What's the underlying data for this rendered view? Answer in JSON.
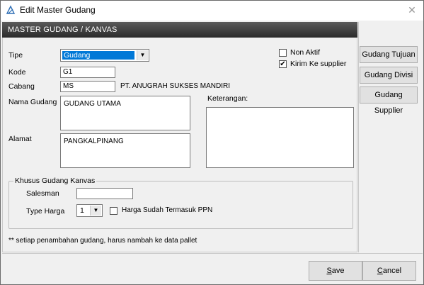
{
  "window": {
    "title": "Edit Master Gudang"
  },
  "header": {
    "title": "MASTER  GUDANG / KANVAS"
  },
  "form": {
    "tipe_label": "Tipe",
    "tipe_value": "Gudang",
    "kode_label": "Kode",
    "kode_value": "G1",
    "cabang_label": "Cabang",
    "cabang_value": "MS",
    "cabang_name": "PT. ANUGRAH SUKSES MANDIRI",
    "nama_label": "Nama Gudang",
    "nama_value": "GUDANG UTAMA",
    "alamat_label": "Alamat",
    "alamat_value": "PANGKALPINANG",
    "keterangan_label": "Keterangan:",
    "keterangan_value": "",
    "non_aktif_label": "Non Aktif",
    "non_aktif_checked": false,
    "kirim_label": "Kirim Ke supplier",
    "kirim_checked": true
  },
  "kanvas": {
    "group_title": "Khusus Gudang Kanvas",
    "salesman_label": "Salesman",
    "salesman_value": "",
    "type_harga_label": "Type Harga",
    "type_harga_value": "1",
    "ppn_label": "Harga Sudah Termasuk PPN",
    "ppn_checked": false
  },
  "note": "** setiap penambahan gudang, harus nambah ke data pallet",
  "side_buttons": {
    "tujuan": "Gudang Tujuan",
    "divisi": "Gudang Divisi",
    "supplier": "Gudang Supplier"
  },
  "buttons": {
    "save_first": "S",
    "save_rest": "ave",
    "cancel_first": "C",
    "cancel_rest": "ancel"
  },
  "icons": {
    "app": "app-logo-icon",
    "close": "close-icon",
    "dropdown": "chevron-down-icon",
    "check": "checkmark-icon"
  }
}
